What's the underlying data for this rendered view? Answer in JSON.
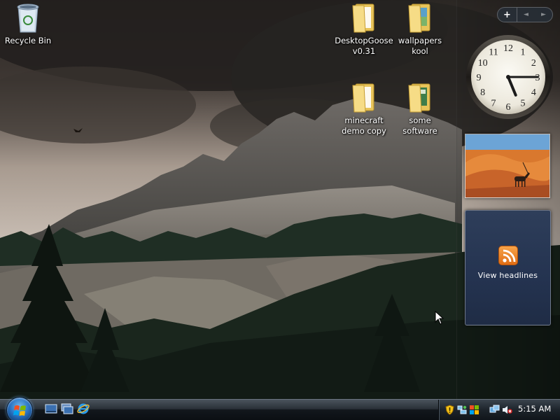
{
  "desktop": {
    "icons": [
      {
        "label": "Recycle Bin",
        "kind": "recycle-bin"
      },
      {
        "label": "DesktopGoose\nv0.31",
        "kind": "folder"
      },
      {
        "label": "wallpapers\nkool",
        "kind": "folder"
      },
      {
        "label": "minecraft\ndemo copy",
        "kind": "folder"
      },
      {
        "label": "some\nsoftware",
        "kind": "folder"
      }
    ]
  },
  "sidebar": {
    "controls": {
      "add": "+",
      "prev": "◄",
      "next": "►"
    },
    "clock": {
      "hours": 5,
      "minutes": 15,
      "numerals": [
        "12",
        "1",
        "2",
        "3",
        "4",
        "5",
        "6",
        "7",
        "8",
        "9",
        "10",
        "11"
      ]
    },
    "slideshow": {
      "subject": "desert oryx"
    },
    "feed": {
      "label": "View headlines",
      "icon": "rss-icon"
    }
  },
  "taskbar": {
    "start_icon": "windows-orb",
    "quick_launch": [
      "show-desktop-icon",
      "switch-windows-icon",
      "internet-explorer-icon"
    ],
    "tray_icons": [
      "security-shield-icon",
      "network-icon",
      "windows-update-icon",
      "network-connection-icon",
      "volume-muted-icon"
    ],
    "time": "5:15 AM"
  },
  "colors": {
    "taskbar": "#0b0f13",
    "feed_gadget": "#243350",
    "rss_orange": "#f08a2a",
    "folder_yellow": "#f4d77a"
  }
}
